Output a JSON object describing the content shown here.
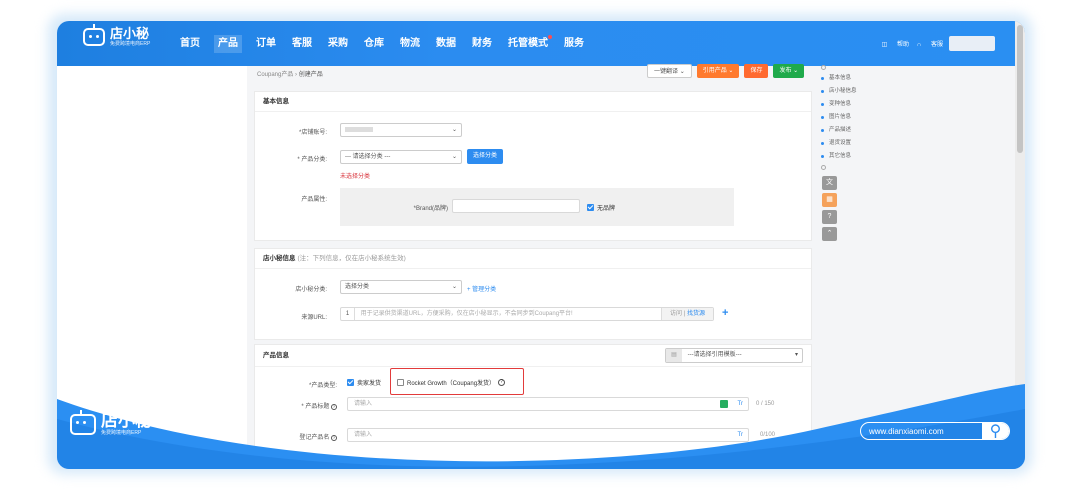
{
  "app": {
    "brand": "店小秘",
    "brand_sub": "免费跨境电商ERP"
  },
  "nav": {
    "items": [
      {
        "label": "首页"
      },
      {
        "label": "产品"
      },
      {
        "label": "订单"
      },
      {
        "label": "客服"
      },
      {
        "label": "采购"
      },
      {
        "label": "仓库"
      },
      {
        "label": "物流"
      },
      {
        "label": "数据"
      },
      {
        "label": "财务"
      },
      {
        "label": "托管模式"
      },
      {
        "label": "服务"
      }
    ],
    "help": "帮助",
    "service": "客服"
  },
  "breadcrumb": {
    "parent": "Coupang产品",
    "sep": "›",
    "current": "创建产品"
  },
  "actions": {
    "translate": "一键翻译",
    "import": "引用产品",
    "save": "保存",
    "publish": "发布"
  },
  "basic": {
    "title": "基本信息",
    "shop_label": "*店铺账号:",
    "category_label": "* 产品分类:",
    "category_placeholder": "--- 请选择分类 ---",
    "choose_category": "选择分类",
    "category_error": "未选择分类",
    "attr_label": "产品属性:",
    "brand_label": "*Brand(品牌)",
    "no_brand": "无品牌"
  },
  "dxm": {
    "title": "店小秘信息",
    "note": "(注：下列信息，仅在店小秘系统生效)",
    "cat_label": "店小秘分类:",
    "cat_value": "选择分类",
    "manage_cat": "+ 管理分类",
    "url_label": "来源URL:",
    "url_index": "1",
    "url_placeholder": "用于记录供货渠道URL，方便采购，仅在店小秘显示，不会同步到Coupang平台!",
    "url_visit": "访问",
    "url_find": "找货源",
    "url_add": "+"
  },
  "product": {
    "title": "产品信息",
    "template_placeholder": "---请选择引用模板---",
    "type_label": "*产品类型:",
    "type_seller": "卖家发货",
    "type_rocket": "Rocket Growth（Coupang发货）",
    "title_label": "* 产品标题",
    "title_placeholder": "请输入",
    "title_count": "0 / 150",
    "reg_label": "登记产品名",
    "reg_placeholder": "请输入",
    "reg_count": "0/100",
    "tr": "Tr"
  },
  "anchor_nav": [
    "基本信息",
    "店小秘信息",
    "变种信息",
    "图片信息",
    "产品描述",
    "退货设置",
    "其它信息"
  ],
  "footer": {
    "url": "www.dianxiaomi.com"
  },
  "colors": {
    "primary": "#2d8cf0",
    "nav_bg": "#2a8ff2",
    "orange": "#ff7a2e",
    "green": "#1faa4b",
    "highlight": "#e23b3b"
  }
}
